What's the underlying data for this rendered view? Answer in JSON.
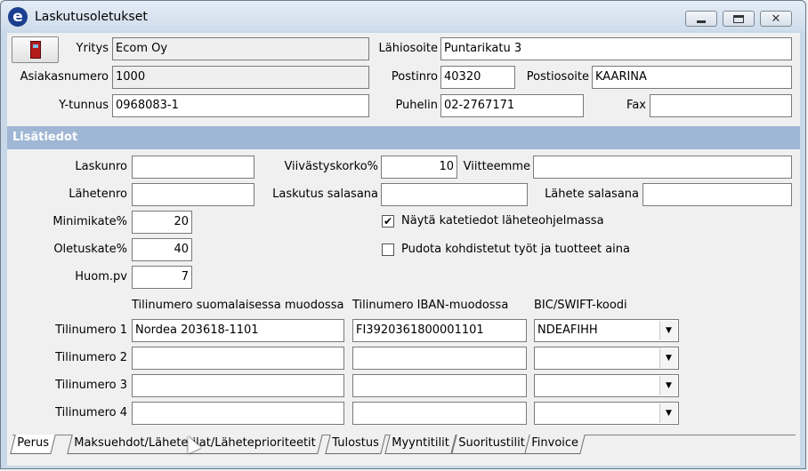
{
  "window": {
    "title": "Laskutusoletukset",
    "app_icon": "e",
    "controls": {
      "minimize": "minimize-icon",
      "maximize": "maximize-icon",
      "close": "close-icon"
    }
  },
  "company": {
    "yritys_label": "Yritys",
    "yritys_value": "Ecom Oy",
    "asiakasnumero_label": "Asiakasnumero",
    "asiakasnumero_value": "1000",
    "ytunnus_label": "Y-tunnus",
    "ytunnus_value": "0968083-1",
    "lahiosoite_label": "Lähiosoite",
    "lahiosoite_value": "Puntarikatu 3",
    "postinro_label": "Postinro",
    "postinro_value": "40320",
    "postiosoite_label": "Postiosoite",
    "postiosoite_value": "KAARINA",
    "puhelin_label": "Puhelin",
    "puhelin_value": "02-2767171",
    "fax_label": "Fax",
    "fax_value": ""
  },
  "section": {
    "title": "Lisätiedot"
  },
  "extra": {
    "laskunro_label": "Laskunro",
    "laskunro_value": "",
    "lahetenro_label": "Lähetenro",
    "lahetenro_value": "",
    "minimikate_label": "Minimikate%",
    "minimikate_value": "20",
    "oletuskate_label": "Oletuskate%",
    "oletuskate_value": "40",
    "huompv_label": "Huom.pv",
    "huompv_value": "7",
    "viivastyskorko_label": "Viivästyskorko%",
    "viivastyskorko_value": "10",
    "viitteemme_label": "Viitteemme",
    "viitteemme_value": "",
    "laskutus_salasana_label": "Laskutus salasana",
    "laskutus_salasana_value": "",
    "lahete_salasana_label": "Lähete salasana",
    "lahete_salasana_value": "",
    "checkbox1_label": "Näytä katetiedot läheteohjelmassa",
    "checkbox1_checked": true,
    "checkbox2_label": "Pudota kohdistetut työt ja tuotteet aina",
    "checkbox2_checked": false
  },
  "accounts": {
    "col_finnish": "Tilinumero suomalaisessa muodossa",
    "col_iban": "Tilinumero IBAN-muodossa",
    "col_bic": "BIC/SWIFT-koodi",
    "rows": [
      {
        "label": "Tilinumero 1",
        "finnish": "Nordea 203618-1101",
        "iban": "FI3920361800001101",
        "bic": "NDEAFIHH"
      },
      {
        "label": "Tilinumero 2",
        "finnish": "",
        "iban": "",
        "bic": ""
      },
      {
        "label": "Tilinumero 3",
        "finnish": "",
        "iban": "",
        "bic": ""
      },
      {
        "label": "Tilinumero 4",
        "finnish": "",
        "iban": "",
        "bic": ""
      }
    ]
  },
  "tabs": [
    {
      "label": "Perus",
      "active": true
    },
    {
      "label": "Maksuehdot/Lähetetilat/Läheteprioriteetit",
      "active": false
    },
    {
      "label": "Tulostus",
      "active": false
    },
    {
      "label": "Myyntitilit",
      "active": false
    },
    {
      "label": "Suoritustilit",
      "active": false
    },
    {
      "label": "Finvoice",
      "active": false
    }
  ]
}
